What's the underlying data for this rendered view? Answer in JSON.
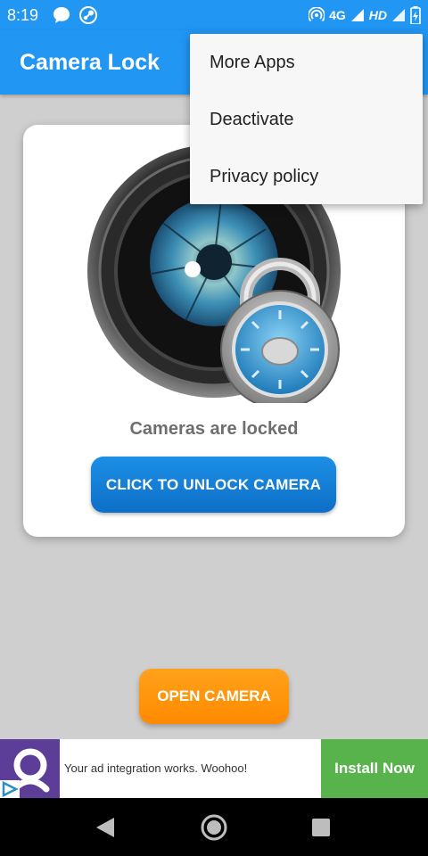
{
  "status_bar": {
    "time": "8:19",
    "network": "4G",
    "hd": "HD",
    "left_icons": [
      "chat-bubble-icon",
      "steam-icon"
    ],
    "right_icons": [
      "hotspot-icon",
      "signal-icon",
      "battery-icon"
    ]
  },
  "app_bar": {
    "title": "Camera Lock",
    "color": "#2196f3"
  },
  "card": {
    "status_text": "Cameras are locked",
    "unlock_label": "CLICK TO UNLOCK CAMERA",
    "image_icon": "camera-lens-padlock-icon"
  },
  "open_camera_label": "OPEN CAMERA",
  "ad": {
    "text": "Your ad integration works. Woohoo!",
    "cta": "Install Now",
    "cta_color": "#59b34d"
  },
  "menu": {
    "items": [
      {
        "label": "More Apps"
      },
      {
        "label": "Deactivate"
      },
      {
        "label": "Privacy policy"
      }
    ]
  },
  "nav_bar": {
    "icons": [
      "back-icon",
      "home-icon",
      "recents-icon"
    ]
  }
}
